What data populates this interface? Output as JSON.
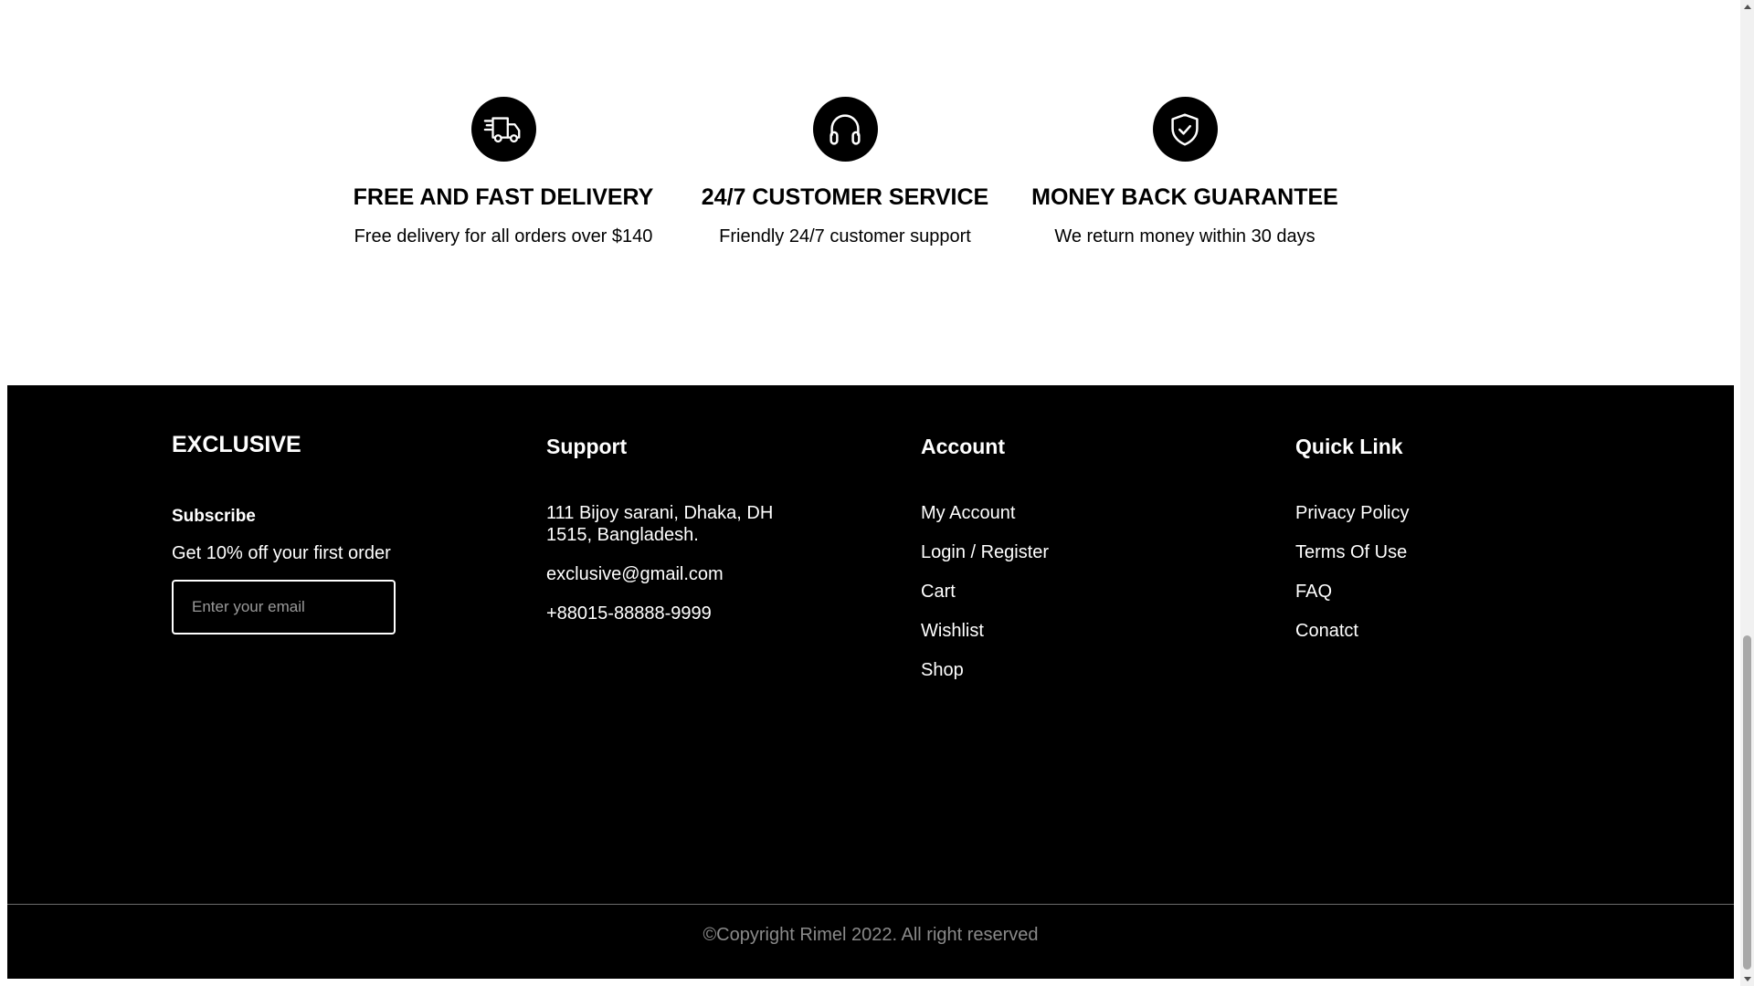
{
  "features": [
    {
      "icon": "delivery-truck-icon",
      "title": "FREE AND FAST DELIVERY",
      "description": "Free delivery for all orders over $140"
    },
    {
      "icon": "headphones-icon",
      "title": "24/7 CUSTOMER SERVICE",
      "description": "Friendly 24/7 customer support"
    },
    {
      "icon": "shield-check-icon",
      "title": "MONEY BACK GUARANTEE",
      "description": "We return money within 30 days"
    }
  ],
  "footer": {
    "brand": "EXCLUSIVE",
    "subscribe": {
      "title": "Subscribe",
      "text": "Get 10% off your first order",
      "placeholder": "Enter your email"
    },
    "support": {
      "heading": "Support",
      "address_line1": "111 Bijoy sarani, Dhaka, DH",
      "address_line2": "1515, Bangladesh.",
      "email": "exclusive@gmail.com",
      "phone": "+88015-88888-9999"
    },
    "account": {
      "heading": "Account",
      "links": [
        "My Account",
        "Login / Register",
        "Cart",
        "Wishlist",
        "Shop"
      ]
    },
    "quick_link": {
      "heading": "Quick Link",
      "links": [
        "Privacy Policy",
        "Terms Of Use",
        "FAQ",
        "Conatct"
      ]
    },
    "copyright": "©Copyright Rimel 2022. All right reserved"
  },
  "colors": {
    "footer_bg": "#000000",
    "footer_text": "#ffffff",
    "copyright_text": "#8a8a8a",
    "icon_bg": "#000000"
  }
}
